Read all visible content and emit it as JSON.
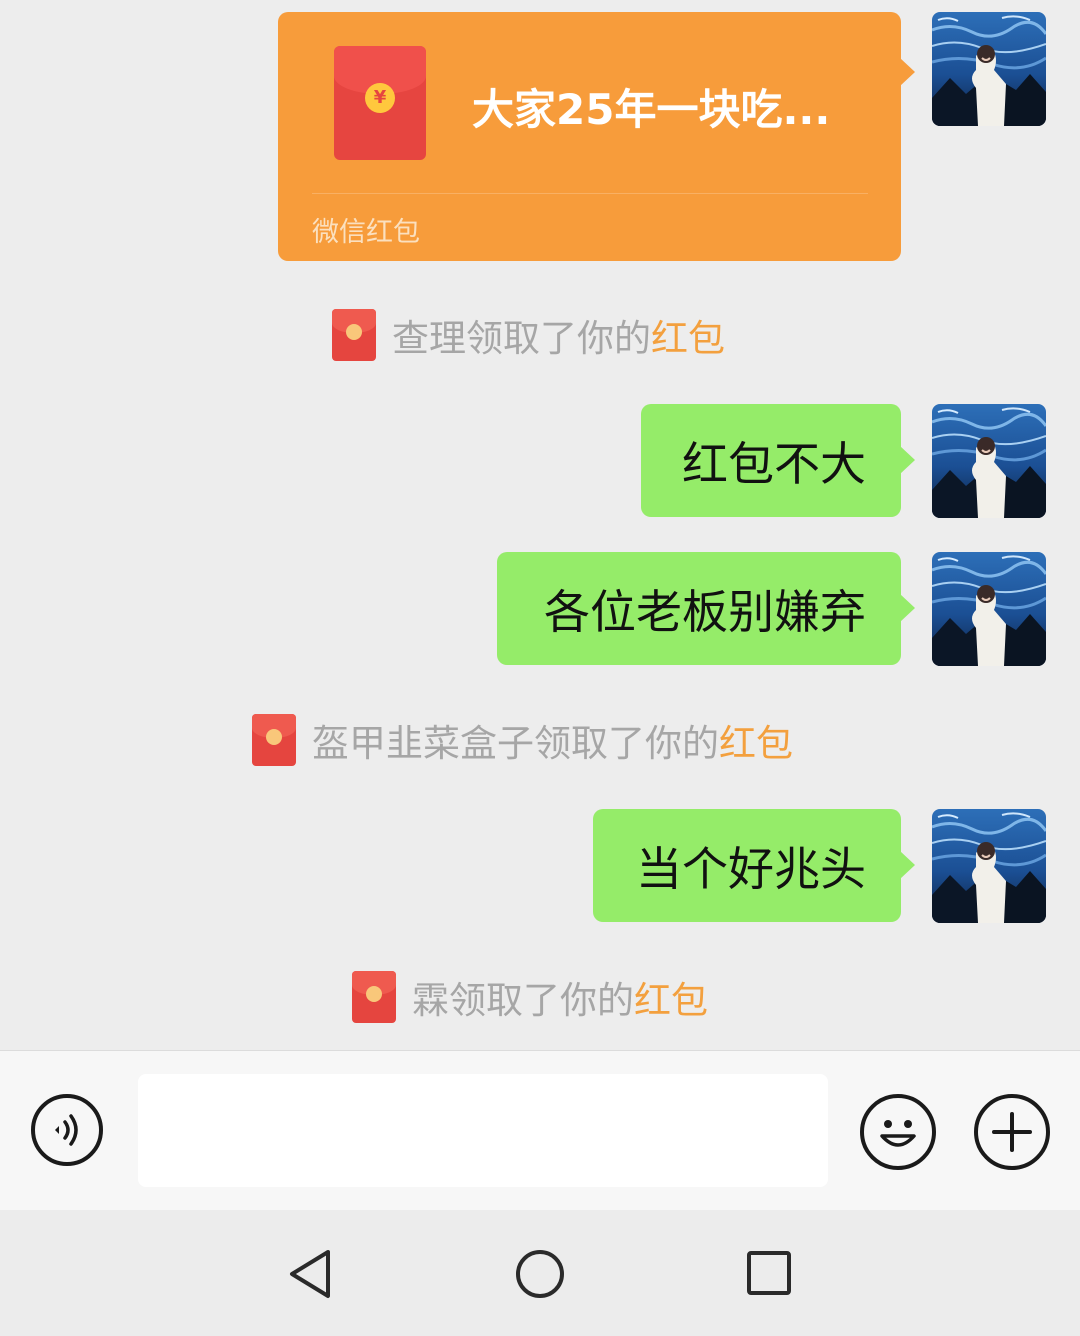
{
  "chat": {
    "red_packet_card": {
      "title": "大家25年一块吃...",
      "footer": "微信红包",
      "coin_symbol": "¥"
    },
    "messages": [
      {
        "type": "notice",
        "text": "查理领取了你的",
        "link": "红包"
      },
      {
        "type": "text",
        "text": "红包不大"
      },
      {
        "type": "text",
        "text": "各位老板别嫌弃"
      },
      {
        "type": "notice",
        "text": "盔甲韭菜盒子领取了你的",
        "link": "红包"
      },
      {
        "type": "text",
        "text": "当个好兆头"
      },
      {
        "type": "notice",
        "text": "霖领取了你的",
        "link": "红包"
      }
    ]
  },
  "input_bar": {
    "voice_icon": "voice-icon",
    "emoji_icon": "emoji-icon",
    "plus_icon": "plus-icon",
    "text_value": ""
  },
  "nav_bar": {
    "back_icon": "back-triangle-icon",
    "home_icon": "home-circle-icon",
    "recent_icon": "recent-square-icon"
  },
  "colors": {
    "background": "#ededed",
    "bubble_green": "#95ec69",
    "red_packet_orange": "#f79c3b",
    "red_packet_red": "#e64540",
    "notice_gray": "#a6a6a6",
    "notice_link": "#f3a03e"
  }
}
